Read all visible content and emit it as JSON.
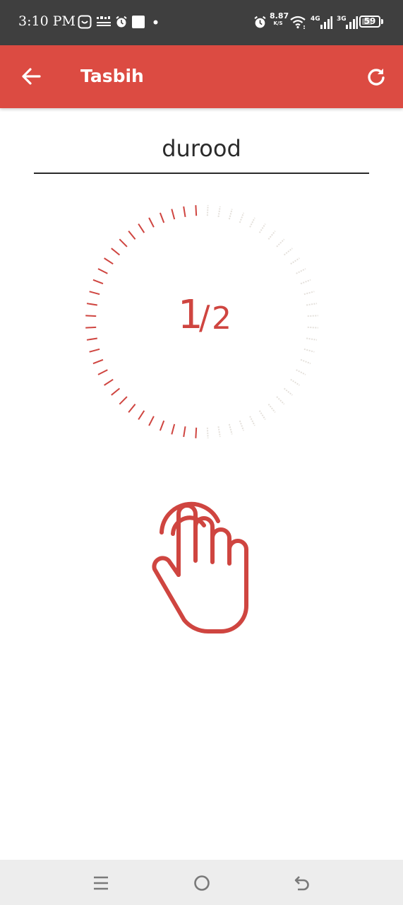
{
  "status_bar": {
    "time": "3:10 PM",
    "notification_icons": [
      "chat-bubble-icon",
      "temu-icon",
      "alarm-icon",
      "square-app-icon",
      "dot-icon"
    ],
    "net_speed_value": "8.87",
    "net_speed_unit": "K/S",
    "signal_1_label": "4G",
    "signal_2_label": "3G",
    "battery_level": "59"
  },
  "app_bar": {
    "title": "Tasbih",
    "back_icon": "arrow-left-icon",
    "reset_icon": "refresh-icon",
    "background_color": "#dc4b42"
  },
  "tasbih": {
    "name_value": "durood",
    "current_count": "1",
    "separator": "/",
    "total_count": "2",
    "progress_fraction": 0.5,
    "accent_color": "#cf4540",
    "inactive_tick_color": "#e4e0db"
  },
  "tap_area": {
    "icon": "tap-hand-icon"
  },
  "nav_bar": {
    "buttons": [
      "menu-icon",
      "home-circle-icon",
      "back-return-icon"
    ]
  }
}
